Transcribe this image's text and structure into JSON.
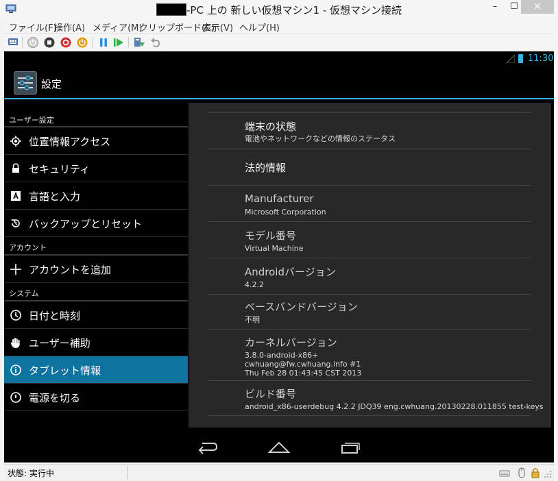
{
  "window": {
    "title_suffix": "-PC 上の 新しい仮想マシン1 - 仮想マシン接続",
    "minimize": "–",
    "maximize": "☐",
    "close": "✕"
  },
  "menu": [
    {
      "label": "ファイル(F)"
    },
    {
      "label": "操作(A)"
    },
    {
      "label": "メディア(M)"
    },
    {
      "label": "クリップボード(C)"
    },
    {
      "label": "表示(V)"
    },
    {
      "label": "ヘルプ(H)"
    }
  ],
  "toolbar": {
    "buttons": [
      "ctrl-alt-del-icon",
      "start-icon",
      "turn-off-icon",
      "shut-down-icon",
      "power-icon",
      "pause-icon",
      "resume-icon",
      "checkpoint-icon",
      "revert-icon"
    ]
  },
  "android": {
    "status": {
      "time": "11:30"
    },
    "actionbar": {
      "title": "設定"
    },
    "sections": {
      "user": "ユーザー設定",
      "account": "アカウント",
      "system": "システム"
    },
    "nav": [
      {
        "label": "位置情報アクセス",
        "icon": "location-icon"
      },
      {
        "label": "セキュリティ",
        "icon": "lock-icon"
      },
      {
        "label": "言語と入力",
        "icon": "keyboard-icon"
      },
      {
        "label": "バックアップとリセット",
        "icon": "backup-icon"
      },
      {
        "label": "アカウントを追加",
        "icon": "plus-icon"
      },
      {
        "label": "日付と時刻",
        "icon": "clock-icon"
      },
      {
        "label": "ユーザー補助",
        "icon": "hand-icon"
      },
      {
        "label": "タブレット情報",
        "icon": "info-icon",
        "active": true
      },
      {
        "label": "電源を切る",
        "icon": "power-icon"
      }
    ],
    "about": [
      {
        "title": "端末の状態",
        "sub": "電池やネットワークなどの情報のステータス"
      },
      {
        "title": "法的情報",
        "sub": ""
      },
      {
        "title": "Manufacturer",
        "sub": "Microsoft Corporation"
      },
      {
        "title": "モデル番号",
        "sub": "Virtual Machine"
      },
      {
        "title": "Androidバージョン",
        "sub": "4.2.2"
      },
      {
        "title": "ベースバンドバージョン",
        "sub": "不明"
      },
      {
        "title": "カーネルバージョン",
        "sub_lines": [
          "3.8.0-android-x86+",
          "cwhuang@fw.cwhuang.info #1",
          "Thu Feb 28 01:43:45 CST 2013"
        ]
      },
      {
        "title": "ビルド番号",
        "sub": "android_x86-userdebug 4.2.2 JDQ39 eng.cwhuang.20130228.011855 test-keys"
      }
    ]
  },
  "statusbar": {
    "state": "状態: 実行中"
  },
  "colors": {
    "accent": "#33b5e5",
    "selected": "#0f73a0",
    "pane": "#282828"
  }
}
